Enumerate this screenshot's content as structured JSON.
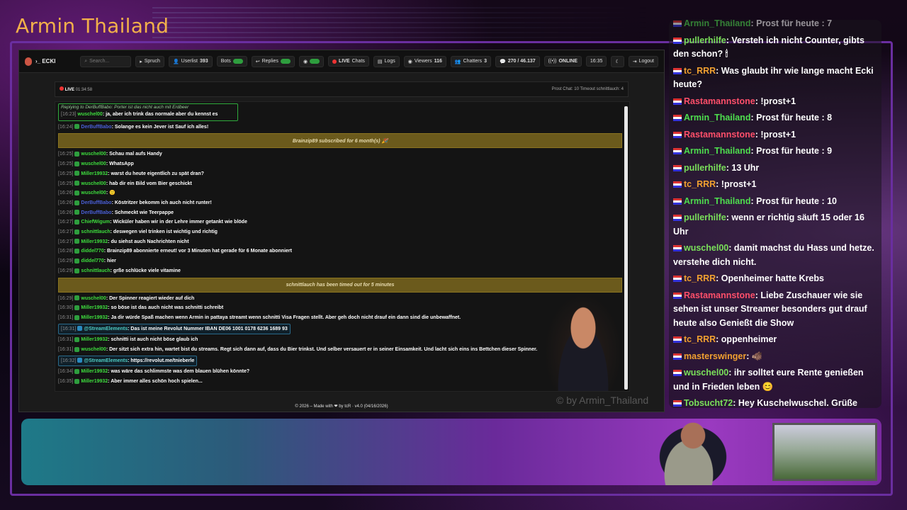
{
  "brand": "Armin Thailand",
  "app": {
    "logo": "›_ ECKI",
    "search_placeholder": "Search...",
    "toolbar": {
      "spruch": "Spruch",
      "userlist": "Userlist",
      "userlist_count": "393",
      "bots": "Bots",
      "replies": "Replies",
      "live_label": "LIVE",
      "chats_label": "Chats",
      "logs": "Logs",
      "viewers": "Viewers",
      "viewers_count": "116",
      "chatters": "Chatters",
      "chatters_count": "3",
      "messages": "270 / 46.137",
      "online": "ONLINE",
      "time": "16:35",
      "logout": "Logout"
    },
    "status": {
      "live": "LIVE",
      "duration": "01:34:58",
      "right": "Prost Chat: 10   Timeout schnittlauch: 4"
    },
    "footer": "© 2026 – Made with ❤ by tcR · v4.0 (04/16/2026)",
    "watermark": "© by Armin_Thailand",
    "reply": {
      "label": "Replying to DerBuffBabo: Porter ist das nicht auch mit Erdbeer",
      "time": "[16:23]",
      "user": "wuschel00",
      "text": ": ja, aber ich trink das normale aber du kennst es"
    },
    "messages": [
      {
        "time": "[16:24]",
        "user": "DerBuffBabo",
        "color": "b",
        "text": ": Solange es kein Jever ist Sauf ich alles!"
      },
      {
        "system": "Brainzip89 subscribed for 6 month(s) 🎉"
      },
      {
        "time": "[16:25]",
        "user": "wuschel00",
        "color": "g",
        "text": ": Schau mal aufs Handy"
      },
      {
        "time": "[16:25]",
        "user": "wuschel00",
        "color": "g",
        "text": ": WhatsApp"
      },
      {
        "time": "[16:25]",
        "user": "Miller19932",
        "color": "g",
        "text": ": warst du heute eigentlich zu spät dran?"
      },
      {
        "time": "[16:25]",
        "user": "wuschel00",
        "color": "g",
        "text": ": hab dir ein Bild vom Bier geschickt"
      },
      {
        "time": "[16:26]",
        "user": "wuschel00",
        "color": "g",
        "text": ": 🙂"
      },
      {
        "time": "[16:26]",
        "user": "DerBuffBabo",
        "color": "b",
        "text": ": Köstritzer bekomm ich auch nicht runter!"
      },
      {
        "time": "[16:26]",
        "user": "DerBuffBabo",
        "color": "b",
        "text": ": Schmeckt wie Teerpappe"
      },
      {
        "time": "[16:27]",
        "user": "ChiefWigum",
        "color": "g",
        "text": ": Wicküler haben wir in der Lehre immer getankt wie blöde"
      },
      {
        "time": "[16:27]",
        "user": "schnittlauch",
        "color": "g",
        "text": ": deswegen viel trinken ist wichtig und richtig"
      },
      {
        "time": "[16:27]",
        "user": "Miller19932",
        "color": "g",
        "text": ": du siehst auch Nachrichten nicht"
      },
      {
        "time": "[16:28]",
        "user": "diddel770",
        "color": "g",
        "text": ": Brainzip89 abonnierte erneut! vor 3 Minuten hat gerade für 6 Monate abonniert"
      },
      {
        "time": "[16:29]",
        "user": "diddel770",
        "color": "g",
        "text": ": hier"
      },
      {
        "time": "[16:29]",
        "user": "schnittlauch",
        "color": "g",
        "text": ": grße schlücke viele vitamine"
      },
      {
        "system": "schnittlauch has been timed out for 5 minutes"
      },
      {
        "time": "[16:29]",
        "user": "wuschel00",
        "color": "g",
        "text": ": Der Spinner reagiert wieder auf dich"
      },
      {
        "time": "[16:30]",
        "user": "Miller19932",
        "color": "g",
        "text": ": so böse ist das auch nicht was schnitti schreibt"
      },
      {
        "time": "[16:31]",
        "user": "Miller19932",
        "color": "g",
        "text": ": Ja dir würde Spaß machen wenn Armin in pattaya streamt wenn schnitti Visa Fragen stellt. Aber geh doch nicht drauf ein dann sind die unbewaffnet."
      },
      {
        "time": "[16:31]",
        "user": "@StreamElements",
        "color": "c",
        "text": ": Das ist meine Revolut Nummer IBAN DE06 1001 0178 6236 1689 93",
        "hl": true
      },
      {
        "time": "[16:31]",
        "user": "Miller19932",
        "color": "g",
        "text": ": schnitti ist auch nicht böse glaub ich"
      },
      {
        "time": "[16:31]",
        "user": "wuschel00",
        "color": "g",
        "text": ": Der sitzt sich extra hin, wartet bist du streams. Regt sich dann auf, dass du Bier trinkst. Und selber versauert er in seiner Einsamkeit. Und lacht sich eins ins Bettchen dieser Spinner."
      },
      {
        "time": "[16:32]",
        "user": "@StreamElements",
        "color": "c",
        "text": ": https://revolut.me/tnieberle",
        "hl": true
      },
      {
        "time": "[16:34]",
        "user": "Miller19932",
        "color": "g",
        "text": ": was wäre das schlimmste was dem blauen blühen könnte?"
      },
      {
        "time": "[16:35]",
        "user": "Miller19932",
        "color": "g",
        "text": ": Aber immer alles schön hoch spielen..."
      }
    ]
  },
  "overlay_chat": [
    {
      "user": "Armin_Thailand",
      "cls": "gr",
      "text": ": Prost für heute : 7",
      "faded": true
    },
    {
      "user": "pullerhilfe",
      "cls": "lg",
      "text": ": Versteh ich nicht Counter, gibts den schon? 🕯"
    },
    {
      "user": "tc_RRR",
      "cls": "o",
      "text": ": Was glaubt ihr wie lange macht Ecki heute?"
    },
    {
      "user": "Rastamannstone",
      "cls": "pk",
      "text": ": !prost+1"
    },
    {
      "user": "Armin_Thailand",
      "cls": "gr",
      "text": ": Prost für heute : 8"
    },
    {
      "user": "Rastamannstone",
      "cls": "pk",
      "text": ": !prost+1"
    },
    {
      "user": "Armin_Thailand",
      "cls": "gr",
      "text": ": Prost für heute : 9"
    },
    {
      "user": "pullerhilfe",
      "cls": "lg",
      "text": ": 13 Uhr"
    },
    {
      "user": "tc_RRR",
      "cls": "o",
      "text": ": !prost+1"
    },
    {
      "user": "Armin_Thailand",
      "cls": "gr",
      "text": ": Prost für heute : 10"
    },
    {
      "user": "pullerhilfe",
      "cls": "lg",
      "text": ": wenn er richtig säuft 15 oder 16 Uhr"
    },
    {
      "user": "wuschel00",
      "cls": "lg",
      "text": ": damit machst du Hass und hetze. verstehe dich nicht."
    },
    {
      "user": "tc_RRR",
      "cls": "o",
      "text": ": Openheimer hatte Krebs"
    },
    {
      "user": "Rastamannstone",
      "cls": "pk",
      "text": ": Liebe Zuschauer wie sie sehen ist unser Streamer besonders gut drauf heute also Genießt die Show"
    },
    {
      "user": "tc_RRR",
      "cls": "o",
      "text": ": oppenheimer"
    },
    {
      "user": "masterswinger",
      "cls": "o",
      "text": ": 🐗"
    },
    {
      "user": "wuschel00",
      "cls": "lg",
      "text": ": ihr solltet eure Rente genießen und in Frieden leben 😊"
    },
    {
      "user": "Tobsucht72",
      "cls": "lg",
      "text": ": Hey Kuschelwuschel. Grüße auch hier auf der guten Seite der Macht"
    }
  ]
}
